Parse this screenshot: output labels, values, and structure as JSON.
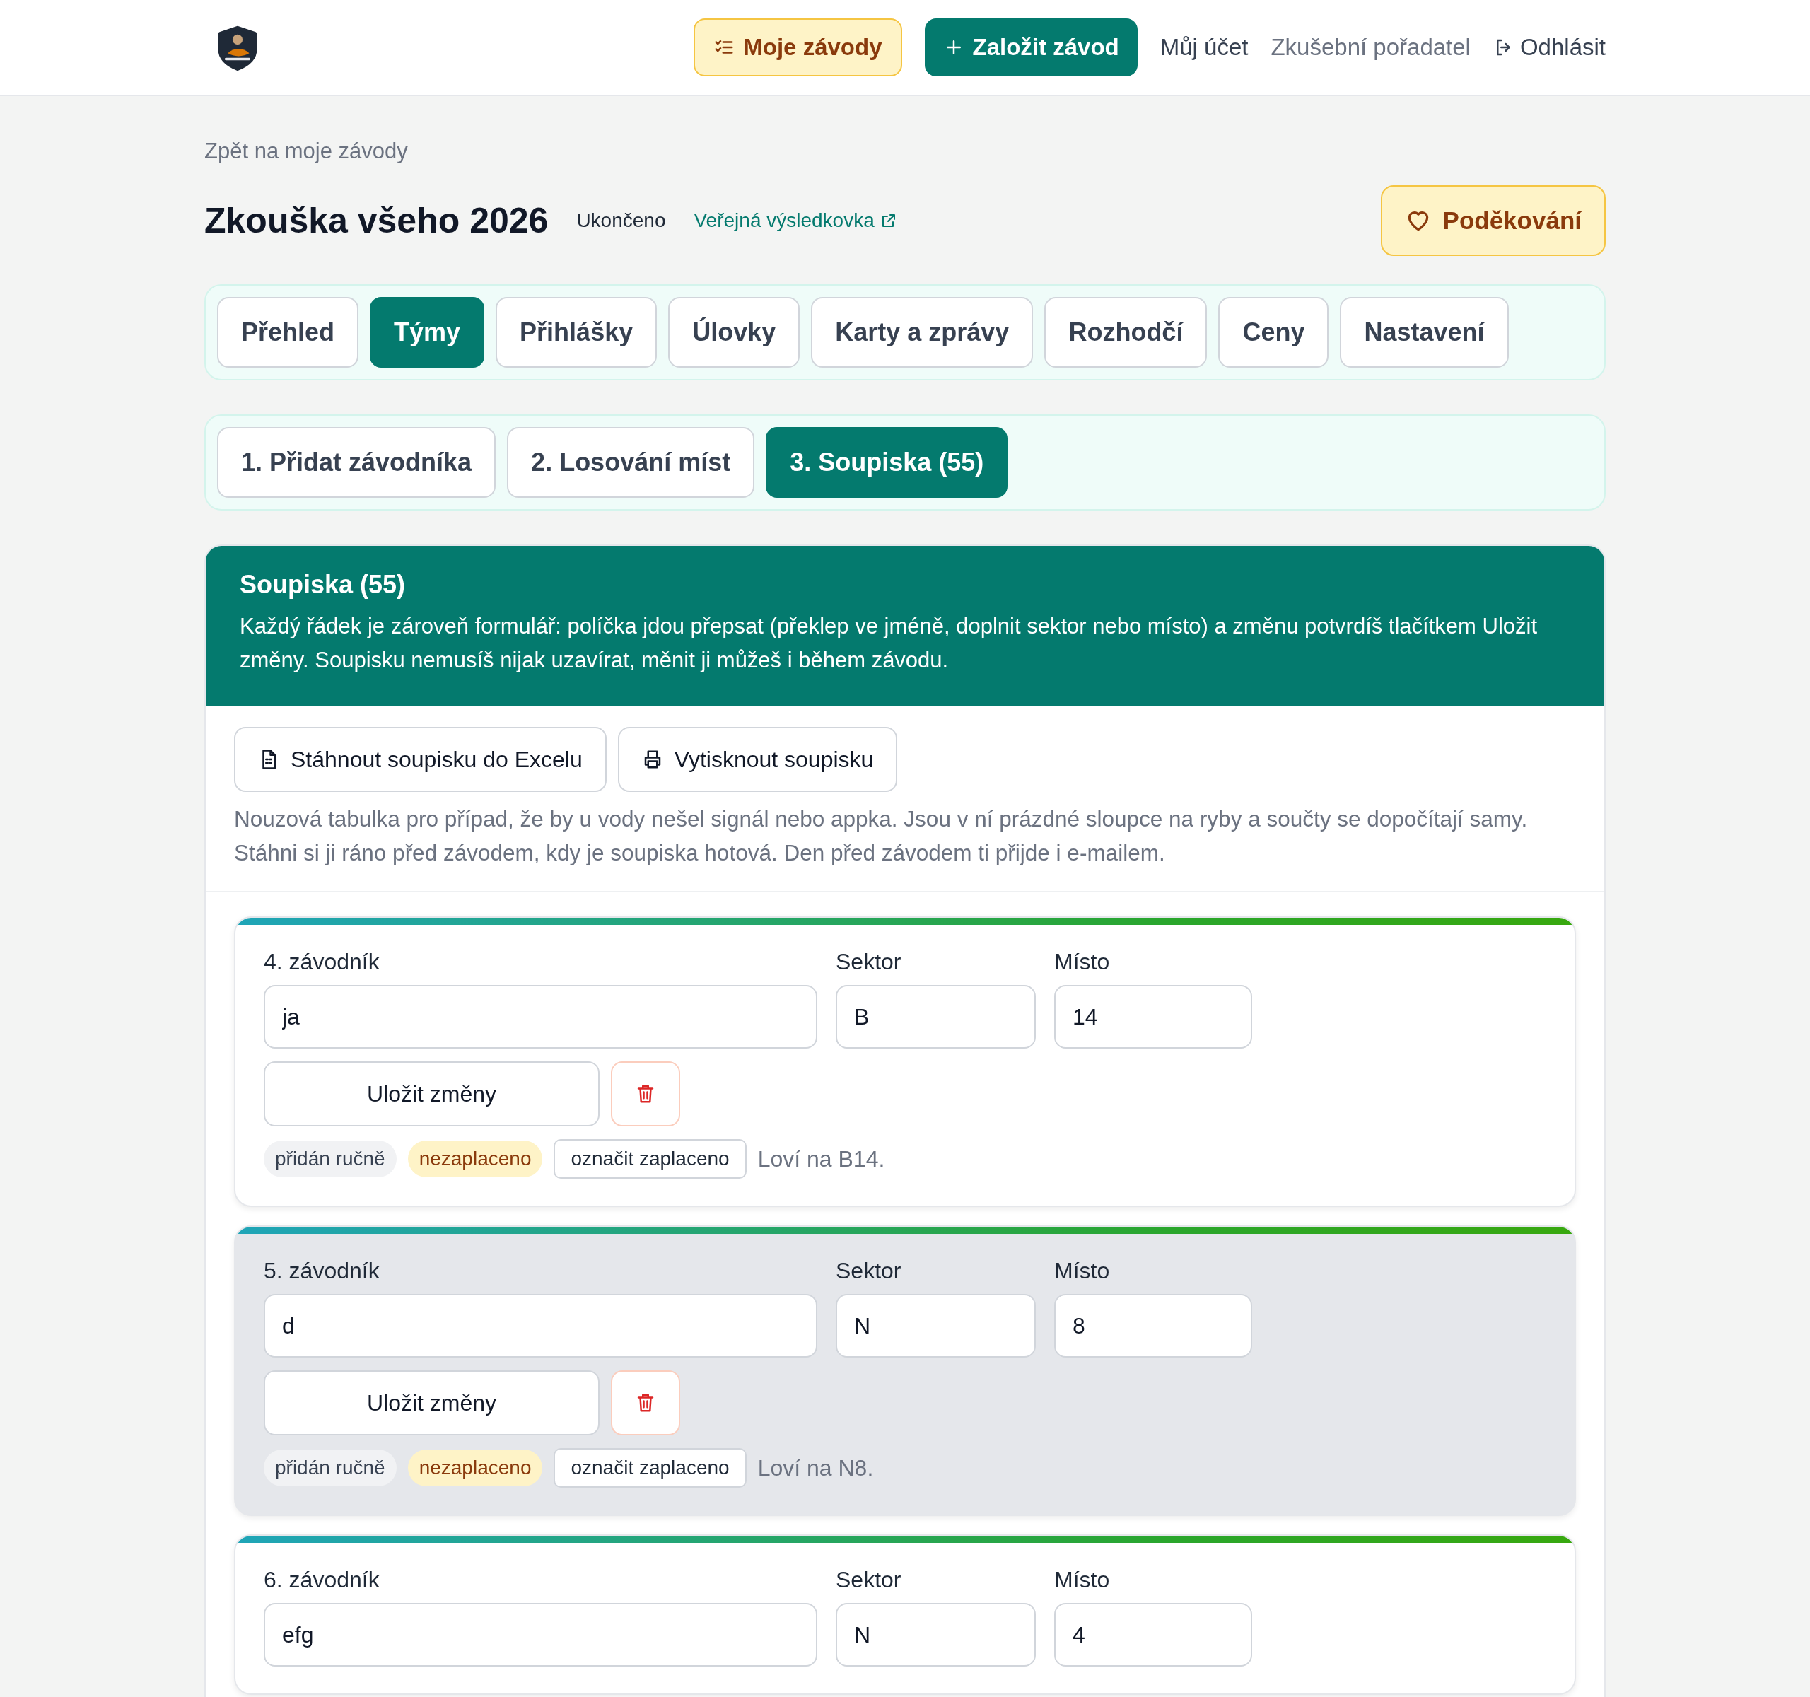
{
  "header": {
    "nav": [
      {
        "kind": "highlight",
        "label": "Moje závody"
      },
      {
        "kind": "primary",
        "label": "Založit závod"
      },
      {
        "kind": "link",
        "label": "Můj účet"
      },
      {
        "kind": "muted",
        "label": "Zkušební pořadatel"
      },
      {
        "kind": "logout",
        "label": "Odhlásit"
      }
    ]
  },
  "back_link": "Zpět na moje závody",
  "competition": {
    "title": "Zkouška všeho 2026",
    "status": "Ukončeno",
    "public_link": "Veřejná výsledkovka",
    "thanks_button": "Poděkování"
  },
  "tabs": [
    {
      "label": "Přehled",
      "selected": false
    },
    {
      "label": "Týmy",
      "selected": true
    },
    {
      "label": "Přihlášky",
      "selected": false
    },
    {
      "label": "Úlovky",
      "selected": false
    },
    {
      "label": "Karty a zprávy",
      "selected": false
    },
    {
      "label": "Rozhodčí",
      "selected": false
    },
    {
      "label": "Ceny",
      "selected": false
    },
    {
      "label": "Nastavení",
      "selected": false
    }
  ],
  "steps": [
    {
      "label": "1. Přidat závodníka",
      "selected": false
    },
    {
      "label": "2. Losování míst",
      "selected": false
    },
    {
      "label": "3. Soupiska (55)",
      "selected": true
    }
  ],
  "roster": {
    "title": "Soupiska (55)",
    "description": "Každý řádek je zároveň formulář: políčka jdou přepsat (překlep ve jméně, doplnit sektor nebo místo) a změnu potvrdíš tlačítkem Uložit změny. Soupisku nemusíš nijak uzavírat, měnit ji můžeš i během závodu.",
    "actions": [
      {
        "kind": "excel",
        "label": "Stáhnout soupisku do Excelu"
      },
      {
        "kind": "print",
        "label": "Vytisknout soupisku"
      }
    ],
    "note": "Nouzová tabulka pro případ, že by u vody nešel signál nebo appka. Jsou v ní prázdné sloupce na ryby a součty se dopočítají samy. Stáhni si ji ráno před závodem, kdy je soupiska hotová. Den před závodem ti přijde i e-mailem.",
    "racers": [
      {
        "label": "4. závodník",
        "name": "ja",
        "sector_label": "Sektor",
        "sector": "B",
        "place_label": "Místo",
        "place": "14",
        "highlighted": false,
        "save_button": "Uložit změny",
        "badges": [
          {
            "kind": "neutral",
            "text": "přidán ručně"
          },
          {
            "kind": "warning",
            "text": "nezaplaceno"
          }
        ],
        "mark_paid": "označit zaplaceno",
        "location": "Loví na B14."
      },
      {
        "label": "5. závodník",
        "name": "d",
        "sector_label": "Sektor",
        "sector": "N",
        "place_label": "Místo",
        "place": "8",
        "highlighted": true,
        "save_button": "Uložit změny",
        "badges": [
          {
            "kind": "neutral",
            "text": "přidán ručně"
          },
          {
            "kind": "warning",
            "text": "nezaplaceno"
          }
        ],
        "mark_paid": "označit zaplaceno",
        "location": "Loví na N8."
      },
      {
        "label": "6. závodník",
        "name": "efg",
        "sector_label": "Sektor",
        "sector": "N",
        "place_label": "Místo",
        "place": "4",
        "highlighted": false
      }
    ]
  }
}
